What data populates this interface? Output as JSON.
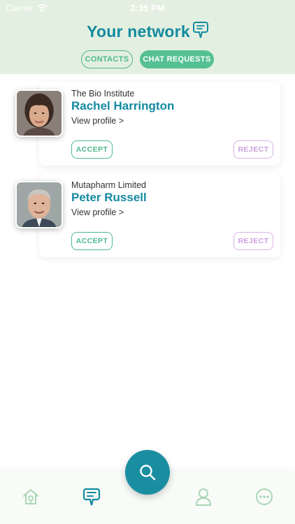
{
  "status_bar": {
    "carrier": "Carrier",
    "time": "2:35 PM"
  },
  "header": {
    "title": "Your network",
    "title_icon": "chat-bubble-icon"
  },
  "tabs": [
    {
      "label": "CONTACTS",
      "selected": false
    },
    {
      "label": "CHAT REQUESTS",
      "selected": true
    }
  ],
  "requests": [
    {
      "organization": "The Bio Institute",
      "name": "Rachel Harrington",
      "view_profile": "View profile >",
      "accept_label": "ACCEPT",
      "reject_label": "REJECT"
    },
    {
      "organization": "Mutapharm Limited",
      "name": "Peter Russell",
      "view_profile": "View profile >",
      "accept_label": "ACCEPT",
      "reject_label": "REJECT"
    }
  ],
  "tabbar": {
    "items": [
      "home-icon",
      "chat-icon",
      "search-icon",
      "profile-icon",
      "more-icon"
    ],
    "active": "chat-icon"
  },
  "colors": {
    "header_bg": "#e3efe0",
    "title": "#148aa0",
    "accent_green": "#4db88c",
    "reject_purple": "#cc9fdc",
    "fab": "#1a8ea1"
  }
}
